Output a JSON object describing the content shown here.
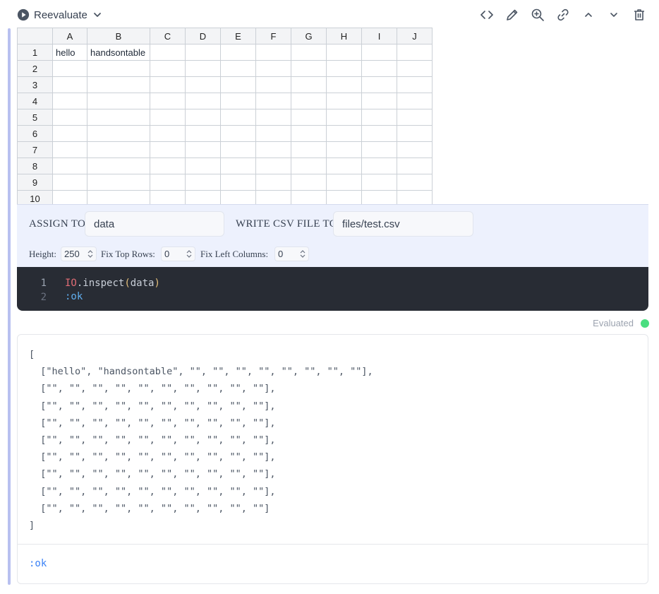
{
  "toolbar": {
    "reevaluate_label": "Reevaluate",
    "buttons": [
      "code-icon",
      "pencil-icon",
      "zoom-in-icon",
      "link-icon",
      "chevron-up-icon",
      "chevron-down-icon",
      "trash-icon"
    ]
  },
  "spreadsheet": {
    "columns": [
      "A",
      "B",
      "C",
      "D",
      "E",
      "F",
      "G",
      "H",
      "I",
      "J"
    ],
    "rows": [
      {
        "num": "1",
        "cells": [
          "hello",
          "handsontable",
          "",
          "",
          "",
          "",
          "",
          "",
          "",
          ""
        ]
      },
      {
        "num": "2",
        "cells": [
          "",
          "",
          "",
          "",
          "",
          "",
          "",
          "",
          "",
          ""
        ]
      },
      {
        "num": "3",
        "cells": [
          "",
          "",
          "",
          "",
          "",
          "",
          "",
          "",
          "",
          ""
        ]
      },
      {
        "num": "4",
        "cells": [
          "",
          "",
          "",
          "",
          "",
          "",
          "",
          "",
          "",
          ""
        ]
      },
      {
        "num": "5",
        "cells": [
          "",
          "",
          "",
          "",
          "",
          "",
          "",
          "",
          "",
          ""
        ]
      },
      {
        "num": "6",
        "cells": [
          "",
          "",
          "",
          "",
          "",
          "",
          "",
          "",
          "",
          ""
        ]
      },
      {
        "num": "7",
        "cells": [
          "",
          "",
          "",
          "",
          "",
          "",
          "",
          "",
          "",
          ""
        ]
      },
      {
        "num": "8",
        "cells": [
          "",
          "",
          "",
          "",
          "",
          "",
          "",
          "",
          "",
          ""
        ]
      },
      {
        "num": "9",
        "cells": [
          "",
          "",
          "",
          "",
          "",
          "",
          "",
          "",
          "",
          ""
        ]
      },
      {
        "num": "10",
        "cells": [
          "",
          "",
          "",
          "",
          "",
          "",
          "",
          "",
          "",
          ""
        ]
      }
    ]
  },
  "config": {
    "assign_label": "ASSIGN TO",
    "assign_value": "data",
    "csv_label": "WRITE CSV FILE TO",
    "csv_value": "files/test.csv",
    "height_label": "Height:",
    "height_value": "250",
    "top_rows_label": "Fix Top Rows:",
    "top_rows_value": "0",
    "left_cols_label": "Fix Left Columns:",
    "left_cols_value": "0"
  },
  "code": {
    "line1_num": "1",
    "line2_num": "2",
    "line1_module": "IO",
    "line1_dot": ".",
    "line1_fn": "inspect",
    "line1_open": "(",
    "line1_arg": "data",
    "line1_close": ")",
    "line2": ":ok"
  },
  "status": {
    "label": "Evaluated",
    "color": "#4ade80"
  },
  "output": {
    "text": "[\n  [\"hello\", \"handsontable\", \"\", \"\", \"\", \"\", \"\", \"\", \"\", \"\"],\n  [\"\", \"\", \"\", \"\", \"\", \"\", \"\", \"\", \"\", \"\"],\n  [\"\", \"\", \"\", \"\", \"\", \"\", \"\", \"\", \"\", \"\"],\n  [\"\", \"\", \"\", \"\", \"\", \"\", \"\", \"\", \"\", \"\"],\n  [\"\", \"\", \"\", \"\", \"\", \"\", \"\", \"\", \"\", \"\"],\n  [\"\", \"\", \"\", \"\", \"\", \"\", \"\", \"\", \"\", \"\"],\n  [\"\", \"\", \"\", \"\", \"\", \"\", \"\", \"\", \"\", \"\"],\n  [\"\", \"\", \"\", \"\", \"\", \"\", \"\", \"\", \"\", \"\"],\n  [\"\", \"\", \"\", \"\", \"\", \"\", \"\", \"\", \"\", \"\"]\n]",
    "result": ":ok"
  }
}
